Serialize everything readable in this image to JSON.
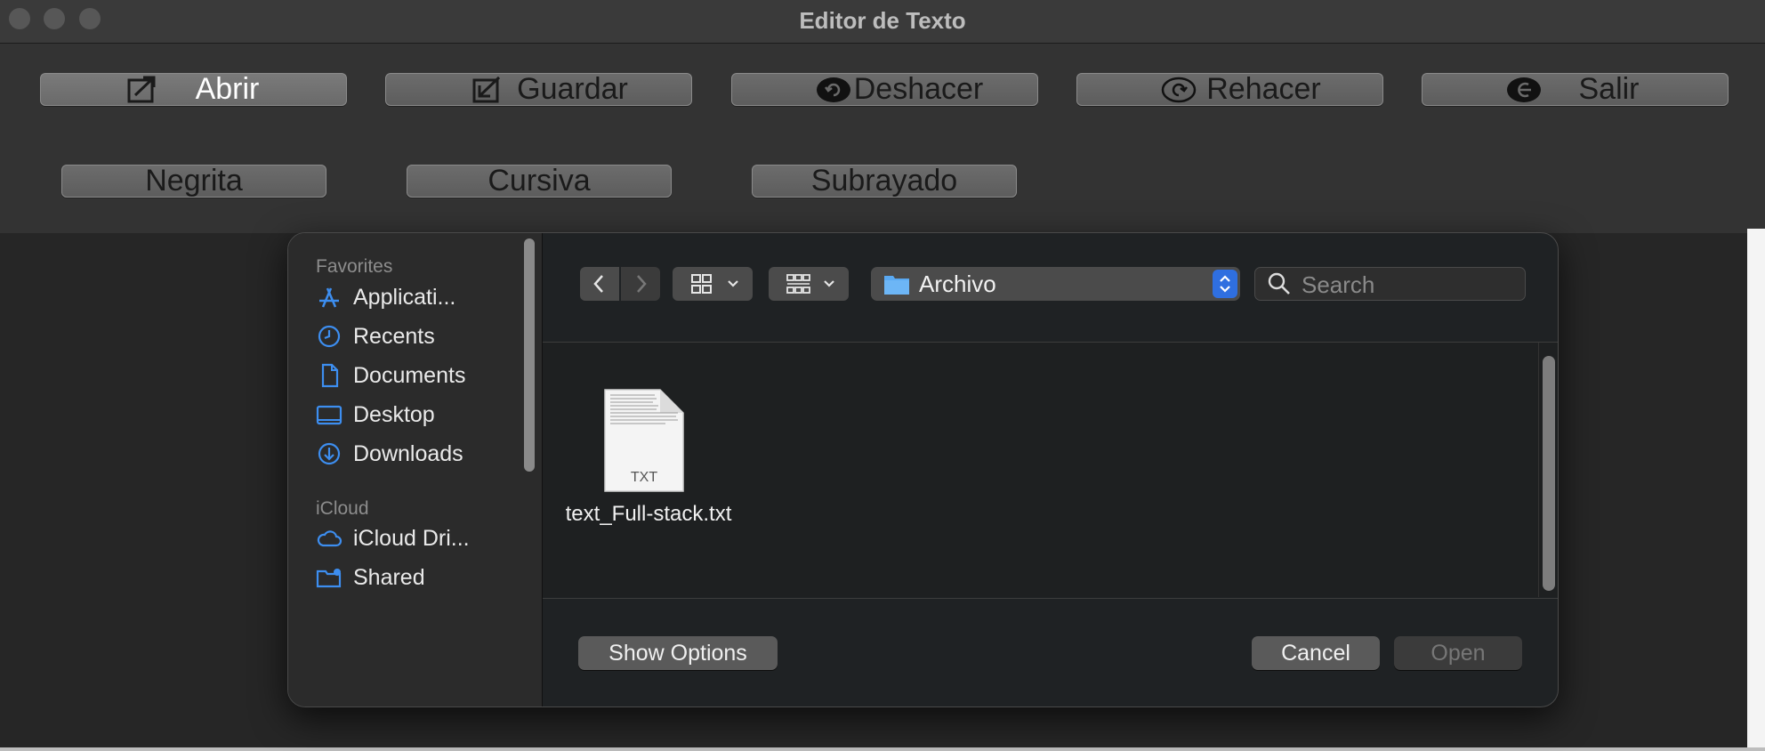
{
  "window": {
    "title": "Editor de Texto"
  },
  "toolbar": {
    "row1": [
      {
        "label": "Abrir",
        "icon": "open-arrow-icon"
      },
      {
        "label": "Guardar",
        "icon": "save-arrow-icon"
      },
      {
        "label": "Deshacer",
        "icon": "undo-icon"
      },
      {
        "label": "Rehacer",
        "icon": "redo-icon"
      },
      {
        "label": "Salir",
        "icon": "exit-icon"
      }
    ],
    "row2": [
      {
        "label": "Negrita"
      },
      {
        "label": "Cursiva"
      },
      {
        "label": "Subrayado"
      }
    ]
  },
  "dialog": {
    "sidebar": {
      "favorites_header": "Favorites",
      "favorites": [
        {
          "label": "Applicati...",
          "icon": "applications-icon"
        },
        {
          "label": "Recents",
          "icon": "recents-clock-icon"
        },
        {
          "label": "Documents",
          "icon": "document-icon"
        },
        {
          "label": "Desktop",
          "icon": "desktop-icon"
        },
        {
          "label": "Downloads",
          "icon": "downloads-icon"
        }
      ],
      "icloud_header": "iCloud",
      "icloud": [
        {
          "label": "iCloud Dri...",
          "icon": "cloud-icon"
        },
        {
          "label": "Shared",
          "icon": "shared-folder-icon"
        }
      ]
    },
    "location": "Archivo",
    "search": {
      "placeholder": "Search",
      "value": ""
    },
    "files": [
      {
        "name": "text_Full-stack.txt",
        "type": "TXT"
      }
    ],
    "buttons": {
      "show_options": "Show Options",
      "cancel": "Cancel",
      "open": "Open"
    },
    "colors": {
      "accent": "#2f6fe0",
      "sidebar_icon": "#3d8ef0",
      "folder": "#5aa9f2"
    }
  }
}
